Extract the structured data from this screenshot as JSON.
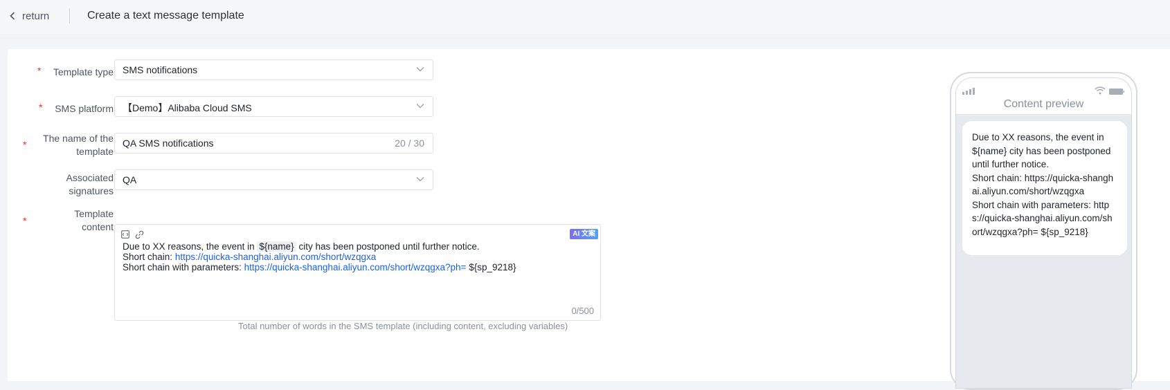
{
  "header": {
    "back_label": "return",
    "title": "Create a text message template"
  },
  "form": {
    "template_type": {
      "label": "Template type",
      "required": true,
      "value": "SMS notifications"
    },
    "sms_platform": {
      "label": "SMS platform",
      "required": true,
      "value": "【Demo】Alibaba Cloud SMS"
    },
    "template_name": {
      "label_line1": "The name of the",
      "label_line2": "template",
      "required": true,
      "value": "QA SMS notifications",
      "count": "20 / 30"
    },
    "signature": {
      "label_line1": "Associated",
      "label_line2": "signatures",
      "required": false,
      "value": "QA"
    },
    "content": {
      "label_line1": "Template",
      "label_line2": "content",
      "required": true,
      "ai_badge": "AI 文案",
      "line1_before": "Due to XX reasons, the event in",
      "line1_var": "${name}",
      "line1_after": "city has been postponed until further notice.",
      "line2_prefix": "Short chain:",
      "line2_link": "https://quicka-shanghai.aliyun.com/short/wzqgxa",
      "line3_prefix": "Short chain with parameters:",
      "line3_link": "https://quicka-shanghai.aliyun.com/short/wzqgxa?ph=",
      "line3_var": "${sp_9218}",
      "counter": "0/500"
    },
    "hint": "Total number of words in the SMS template (including content, excluding variables)"
  },
  "preview": {
    "title": "Content preview",
    "line1": "Due to XX reasons, the event in ${name} city has been postponed until further notice.",
    "line2": "Short chain: https://quicka-shanghai.aliyun.com/short/wzqgxa",
    "line3": "Short chain with parameters: https://quicka-shanghai.aliyun.com/short/wzqgxa?ph= ${sp_9218}"
  },
  "colors": {
    "required": "#e5342b",
    "link": "#1c5fe8",
    "ai_gradient_start": "#7c6df5",
    "ai_gradient_end": "#4ea3f7"
  }
}
